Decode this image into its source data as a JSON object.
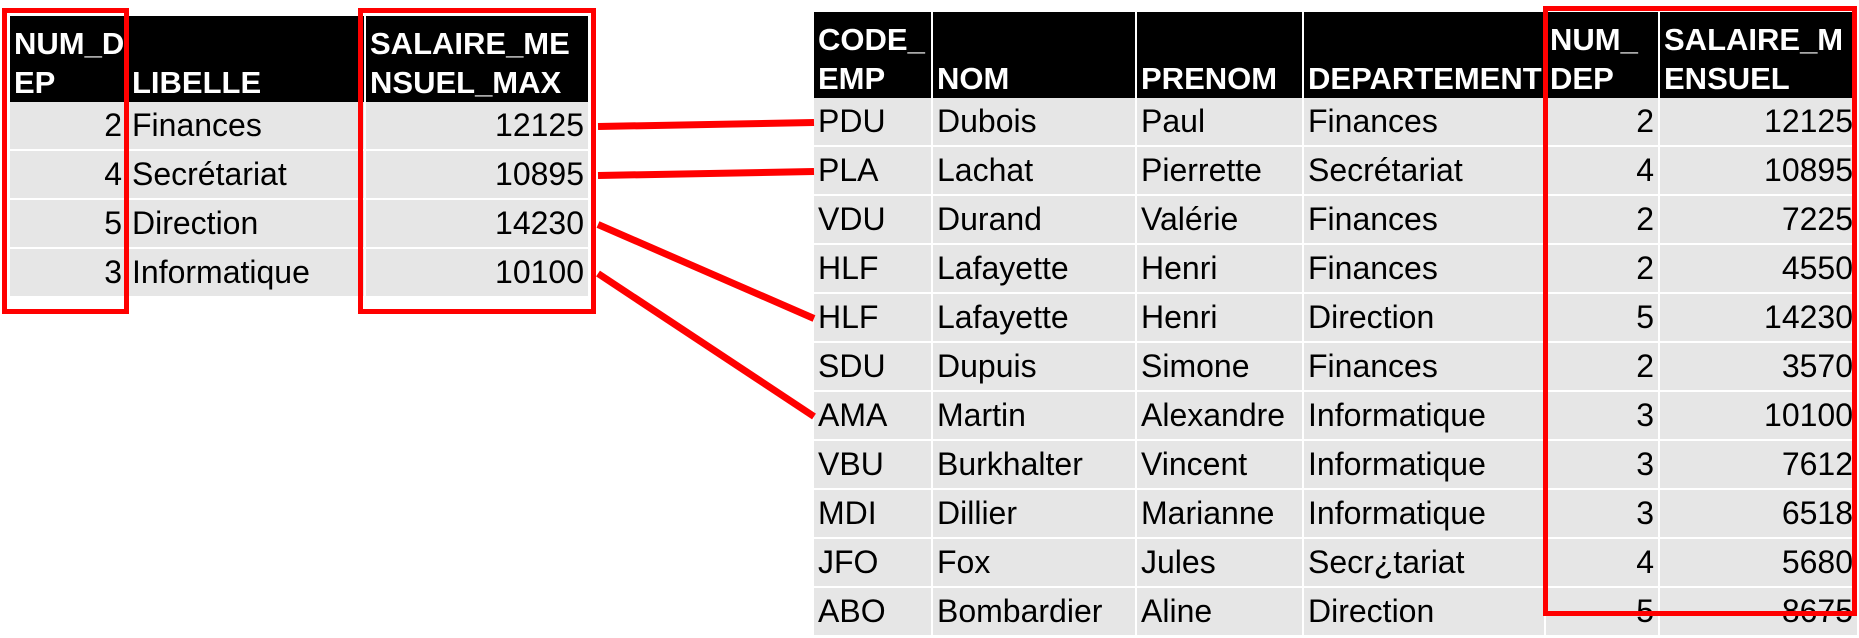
{
  "departments_table": {
    "headers": [
      "NUM_DEP",
      "LIBELLE",
      "SALAIRE_MENSUEL_MAX"
    ],
    "rows": [
      [
        "2",
        "Finances",
        "12125"
      ],
      [
        "4",
        "Secrétariat",
        "10895"
      ],
      [
        "5",
        "Direction",
        "14230"
      ],
      [
        "3",
        "Informatique",
        "10100"
      ]
    ]
  },
  "employees_table": {
    "headers": [
      "CODE_EMP",
      "NOM",
      "PRENOM",
      "DEPARTEMENT",
      "NUM_DEP",
      "SALAIRE_MENSUEL"
    ],
    "rows": [
      [
        "PDU",
        "Dubois",
        "Paul",
        "Finances",
        "2",
        "12125"
      ],
      [
        "PLA",
        "Lachat",
        "Pierrette",
        "Secrétariat",
        "4",
        "10895"
      ],
      [
        "VDU",
        "Durand",
        "Valérie",
        "Finances",
        "2",
        "7225"
      ],
      [
        "HLF",
        "Lafayette",
        "Henri",
        "Finances",
        "2",
        "4550"
      ],
      [
        "HLF",
        "Lafayette",
        "Henri",
        "Direction",
        "5",
        "14230"
      ],
      [
        "SDU",
        "Dupuis",
        "Simone",
        "Finances",
        "2",
        "3570"
      ],
      [
        "AMA",
        "Martin",
        "Alexandre",
        "Informatique",
        "3",
        "10100"
      ],
      [
        "VBU",
        "Burkhalter",
        "Vincent",
        "Informatique",
        "3",
        "7612"
      ],
      [
        "MDI",
        "Dillier",
        "Marianne",
        "Informatique",
        "3",
        "6518"
      ],
      [
        "JFO",
        "Fox",
        "Jules",
        "Secr¿tariat",
        "4",
        "5680"
      ],
      [
        "ABO",
        "Bombardier",
        "Aline",
        "Direction",
        "5",
        "8675"
      ]
    ]
  },
  "links": [
    {
      "from_dept_row": 0,
      "to_emp_row": 0
    },
    {
      "from_dept_row": 1,
      "to_emp_row": 1
    },
    {
      "from_dept_row": 2,
      "to_emp_row": 4
    },
    {
      "from_dept_row": 3,
      "to_emp_row": 6
    }
  ],
  "colors": {
    "header_bg": "#000000",
    "header_text": "#ffffff",
    "cell_bg": "#e6e6e6",
    "highlight": "#ff0000"
  }
}
